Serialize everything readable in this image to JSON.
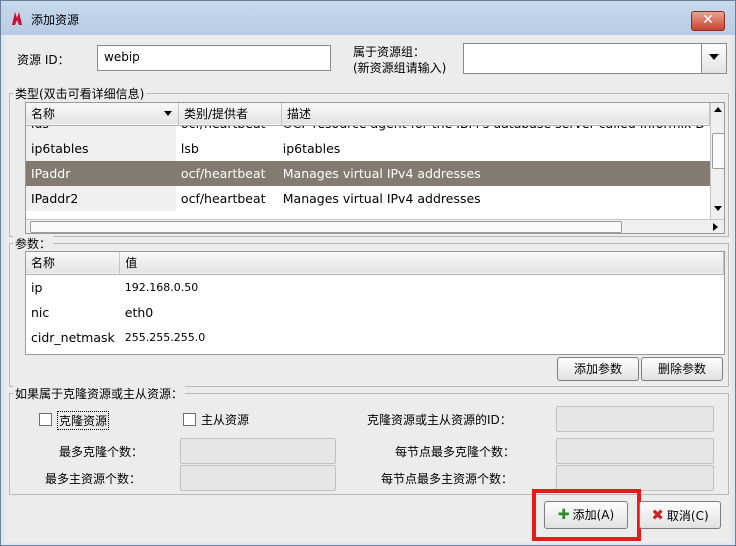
{
  "window": {
    "title": "添加资源",
    "close_label": "✕"
  },
  "top": {
    "resource_id_label": "资源 ID：",
    "resource_id_value": "webip",
    "group_label_line1": "属于资源组：",
    "group_label_line2": "(新资源组请输入)",
    "group_value": ""
  },
  "types": {
    "section_title": "类型(双击可看详细信息)",
    "columns": [
      "名称",
      "类别/提供者",
      "描述"
    ],
    "rows": [
      {
        "name": "ids",
        "provider": "ocf/heartbeat",
        "desc": "OCF resource agent for the IBM's database server called Informix D"
      },
      {
        "name": "ip6tables",
        "provider": "lsb",
        "desc": "ip6tables"
      },
      {
        "name": "IPaddr",
        "provider": "ocf/heartbeat",
        "desc": "Manages virtual IPv4 addresses"
      },
      {
        "name": "IPaddr2",
        "provider": "ocf/heartbeat",
        "desc": "Manages virtual IPv4 addresses"
      }
    ],
    "selected_row": 2
  },
  "params": {
    "section_title": "参数：",
    "columns": [
      "名称",
      "值"
    ],
    "rows": [
      {
        "name": "ip",
        "value": "192.168.0.50"
      },
      {
        "name": "nic",
        "value": "eth0"
      },
      {
        "name": "cidr_netmask",
        "value": "255.255.255.0"
      }
    ],
    "add_label": "添加参数",
    "delete_label": "删除参数"
  },
  "clone": {
    "section_title": "如果属于克隆资源或主从资源：",
    "clone_label": "克隆资源",
    "master_label": "主从资源",
    "clone_checked": false,
    "master_checked": false,
    "id_label": "克隆资源或主从资源的ID：",
    "max_clone_label": "最多克隆个数：",
    "max_master_label": "最多主资源个数：",
    "per_node_clone_label": "每节点最多克隆个数：",
    "per_node_master_label": "每节点最多主资源个数："
  },
  "actions": {
    "add_label": "添加(A)",
    "cancel_label": "取消(C)"
  },
  "colors": {
    "selection": "#837a70",
    "highlight": "#e81a1a"
  }
}
